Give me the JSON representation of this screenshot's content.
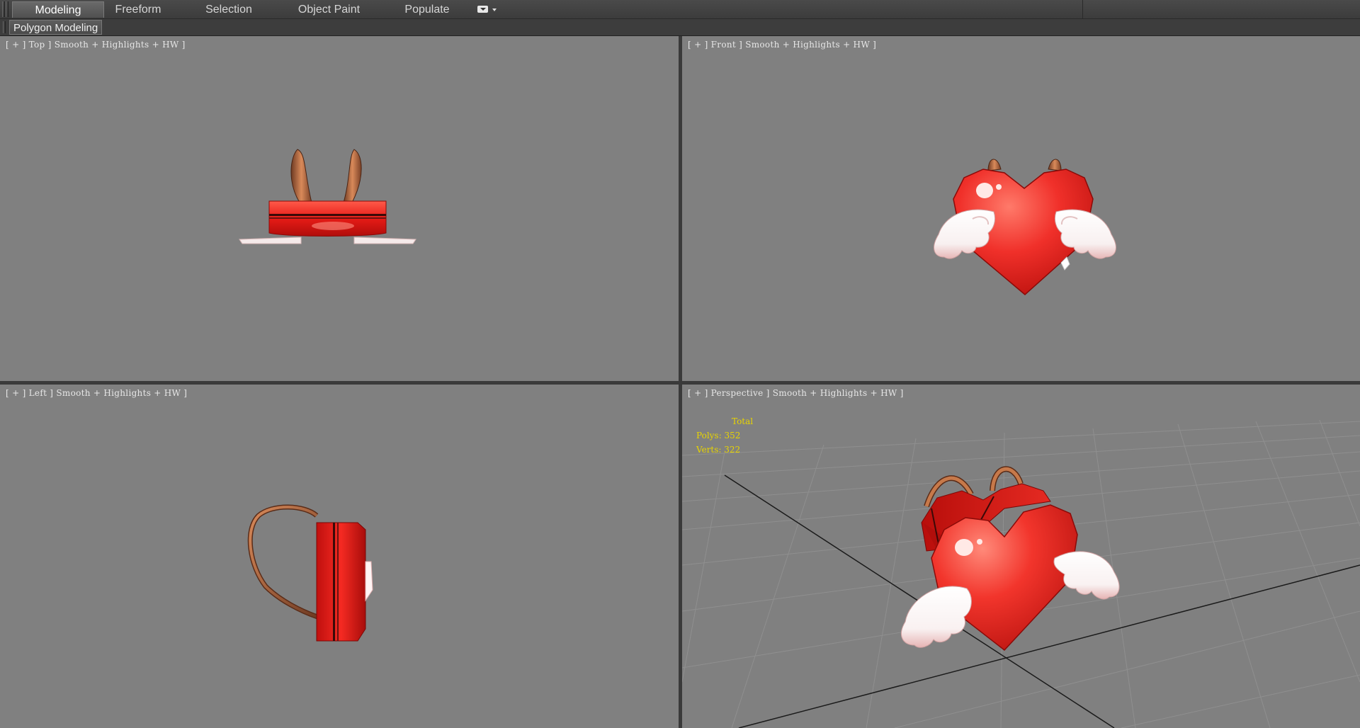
{
  "ribbon": {
    "tabs": [
      {
        "label": "Modeling",
        "active": true
      },
      {
        "label": "Freeform",
        "active": false
      },
      {
        "label": "Selection",
        "active": false
      },
      {
        "label": "Object Paint",
        "active": false
      },
      {
        "label": "Populate",
        "active": false
      }
    ],
    "dropdown_icon": "ribbon-options-icon",
    "panel_label": "Polygon Modeling"
  },
  "viewports": {
    "top": {
      "label": "[ + ] Top ] Smooth + Highlights + HW ]"
    },
    "front": {
      "label": "[ + ] Front ] Smooth + Highlights + HW ]"
    },
    "left": {
      "label": "[ + ] Left ] Smooth + Highlights + HW ]"
    },
    "perspective": {
      "label": "[ + ] Perspective ] Smooth + Highlights + HW ]",
      "stats": {
        "title": "Total",
        "polys_label": "Polys:",
        "polys": "352",
        "verts_label": "Verts:",
        "verts": "322"
      }
    }
  },
  "colors": {
    "viewport_bg": "#808080",
    "heart_red": "#e8201c",
    "strap_brown": "#b86a3e",
    "wing_white": "#ffffff",
    "stats_yellow": "#e8d400"
  }
}
